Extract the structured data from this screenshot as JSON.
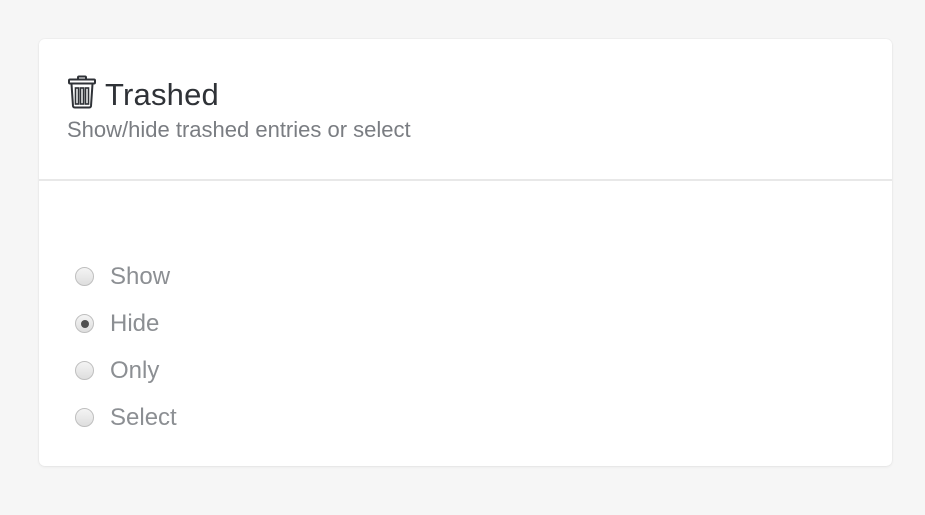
{
  "panel": {
    "title": "Trashed",
    "subtitle": "Show/hide trashed entries or select",
    "icon": "trash-can-icon"
  },
  "options": [
    {
      "label": "Show",
      "checked": false
    },
    {
      "label": "Hide",
      "checked": true
    },
    {
      "label": "Only",
      "checked": false
    },
    {
      "label": "Select",
      "checked": false
    }
  ],
  "colors": {
    "background": "#f6f6f6",
    "card": "#ffffff",
    "title": "#2f3237",
    "subtitle": "#7a7d82",
    "option_label": "#8c8f93"
  }
}
